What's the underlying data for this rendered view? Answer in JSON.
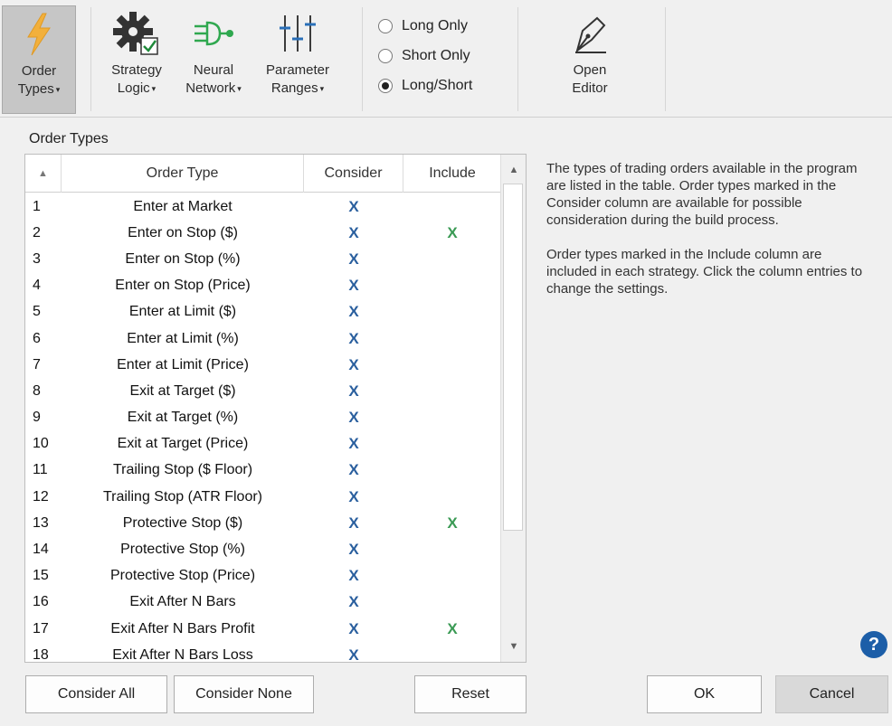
{
  "ribbon": {
    "order_types": {
      "line1": "Order",
      "line2": "Types"
    },
    "strategy_logic": {
      "line1": "Strategy",
      "line2": "Logic"
    },
    "neural_network": {
      "line1": "Neural",
      "line2": "Network"
    },
    "parameter_ranges": {
      "line1": "Parameter",
      "line2": "Ranges"
    },
    "open_editor": {
      "line1": "Open",
      "line2": "Editor"
    },
    "dropdown_arrow": "▾",
    "radios": [
      {
        "label": "Long Only",
        "selected": false
      },
      {
        "label": "Short Only",
        "selected": false
      },
      {
        "label": "Long/Short",
        "selected": true
      }
    ]
  },
  "section_title": "Order Types",
  "table": {
    "headers": {
      "num": "▲",
      "type": "Order Type",
      "consider": "Consider",
      "include": "Include"
    },
    "rows": [
      {
        "num": "1",
        "type": "Enter at Market",
        "consider": "X",
        "include": ""
      },
      {
        "num": "2",
        "type": "Enter on Stop ($)",
        "consider": "X",
        "include": "X"
      },
      {
        "num": "3",
        "type": "Enter on Stop (%)",
        "consider": "X",
        "include": ""
      },
      {
        "num": "4",
        "type": "Enter on Stop (Price)",
        "consider": "X",
        "include": ""
      },
      {
        "num": "5",
        "type": "Enter at Limit ($)",
        "consider": "X",
        "include": ""
      },
      {
        "num": "6",
        "type": "Enter at Limit (%)",
        "consider": "X",
        "include": ""
      },
      {
        "num": "7",
        "type": "Enter at Limit (Price)",
        "consider": "X",
        "include": ""
      },
      {
        "num": "8",
        "type": "Exit at Target ($)",
        "consider": "X",
        "include": ""
      },
      {
        "num": "9",
        "type": "Exit at Target (%)",
        "consider": "X",
        "include": ""
      },
      {
        "num": "10",
        "type": "Exit at Target (Price)",
        "consider": "X",
        "include": ""
      },
      {
        "num": "11",
        "type": "Trailing Stop ($ Floor)",
        "consider": "X",
        "include": ""
      },
      {
        "num": "12",
        "type": "Trailing Stop (ATR Floor)",
        "consider": "X",
        "include": ""
      },
      {
        "num": "13",
        "type": "Protective Stop ($)",
        "consider": "X",
        "include": "X"
      },
      {
        "num": "14",
        "type": "Protective Stop (%)",
        "consider": "X",
        "include": ""
      },
      {
        "num": "15",
        "type": "Protective Stop (Price)",
        "consider": "X",
        "include": ""
      },
      {
        "num": "16",
        "type": "Exit After N Bars",
        "consider": "X",
        "include": ""
      },
      {
        "num": "17",
        "type": "Exit After N Bars Profit",
        "consider": "X",
        "include": "X"
      },
      {
        "num": "18",
        "type": "Exit After N Bars Loss",
        "consider": "X",
        "include": ""
      }
    ]
  },
  "description": {
    "para1": "The types of trading orders available in the program are listed in the table. Order types marked in the Consider column are available for possible consideration during the build process.",
    "para2": "Order types marked in the Include column are included in each strategy. Click the column entries to change the settings."
  },
  "buttons": {
    "consider_all": "Consider All",
    "consider_none": "Consider None",
    "reset": "Reset",
    "ok": "OK",
    "cancel": "Cancel",
    "help": "?"
  },
  "colors": {
    "consider_x": "#2a5f9e",
    "include_x": "#3a9a54",
    "lightning": "#f2b03c",
    "network_green": "#2fa84f"
  }
}
